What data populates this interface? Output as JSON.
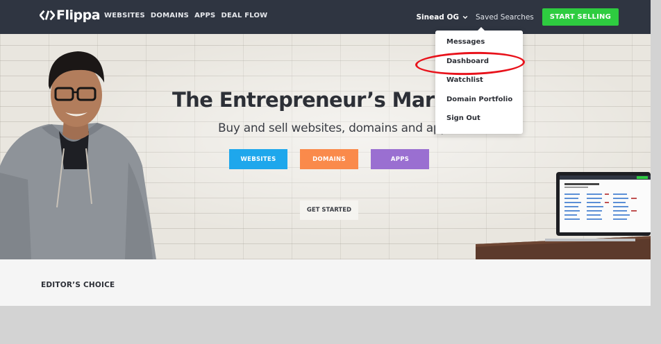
{
  "nav": {
    "logo_text": "Flippa",
    "links": [
      "WEBSITES",
      "DOMAINS",
      "APPS",
      "DEAL FLOW"
    ],
    "user_name": "Sinead OG",
    "saved_searches": "Saved Searches",
    "start_selling": "START SELLING"
  },
  "user_menu": {
    "items": [
      "Messages",
      "Dashboard",
      "Watchlist",
      "Domain Portfolio",
      "Sign Out"
    ]
  },
  "hero": {
    "title": "The Entrepreneur’s Market",
    "subtitle": "Buy and sell websites, domains and app",
    "buttons": [
      "WEBSITES",
      "DOMAINS",
      "APPS"
    ],
    "get_started": "GET STARTED"
  },
  "editors_choice": {
    "title": "EDITOR’S CHOICE"
  },
  "colors": {
    "nav_bg": "#2f3541",
    "start_selling": "#2ecc40",
    "websites": "#1ea7ec",
    "domains": "#fa8a4b",
    "apps": "#9a6fd1",
    "highlight": "#e8121b"
  },
  "icons": {
    "logo": "flippa-logo-icon",
    "user_menu": "chevron-down-icon"
  }
}
